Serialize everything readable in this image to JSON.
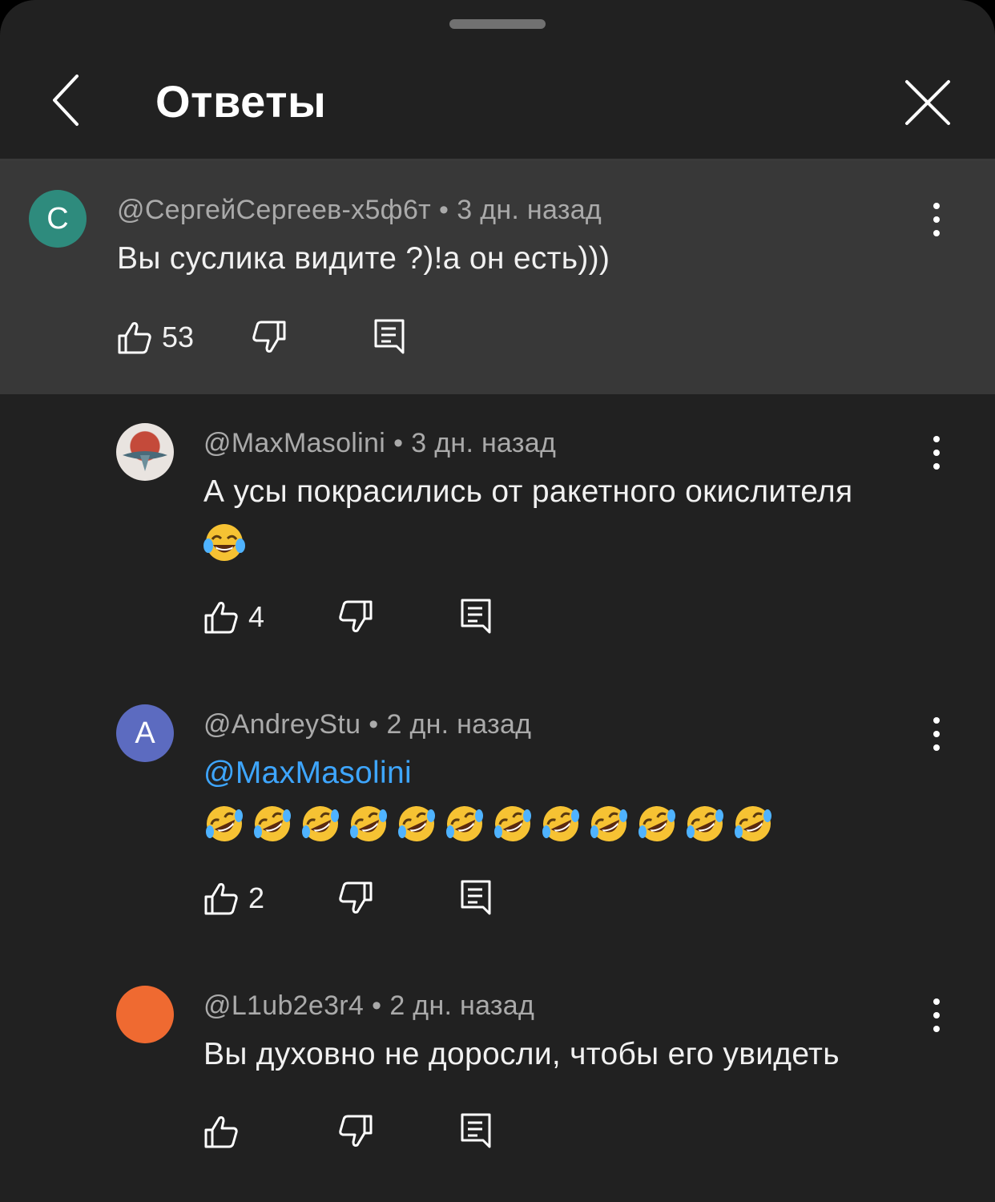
{
  "header": {
    "title": "Ответы",
    "back_icon": "chevron-left-icon",
    "close_icon": "close-icon"
  },
  "colors": {
    "sheet_bg": "#212121",
    "highlight_bg": "#383838",
    "mention": "#3ea6ff",
    "secondary_text": "#aaaaaa"
  },
  "parent_comment": {
    "avatar_letter": "С",
    "avatar_color": "#2e8b7d",
    "author": "@СергейСергеев-х5ф6т",
    "time": "3 дн. назад",
    "text": "Вы суслика видите ?)!а он есть)))",
    "likes": "53"
  },
  "replies": [
    {
      "author": "@MaxMasolini",
      "time": "3 дн. назад",
      "text": "А усы покрасились от ракетного окислителя",
      "emoji": [
        "face-with-tears-of-joy"
      ],
      "likes": "4",
      "avatar": "image"
    },
    {
      "avatar_letter": "A",
      "avatar_color": "#5c6bc0",
      "author": "@AndreyStu",
      "time": "2 дн. назад",
      "mention": "@MaxMasolini",
      "emoji_count": 12,
      "emoji": "rolling-on-the-floor-laughing",
      "likes": "2"
    },
    {
      "avatar_letter": "",
      "avatar_color": "#ef6a31",
      "author": "@L1ub2e3r4",
      "time": "2 дн. назад",
      "text": "Вы духовно не доросли, чтобы его увидеть",
      "likes": ""
    }
  ],
  "actions": {
    "like_icon": "thumbs-up-icon",
    "dislike_icon": "thumbs-down-icon",
    "reply_icon": "reply-icon",
    "menu_icon": "more-vert-icon"
  }
}
